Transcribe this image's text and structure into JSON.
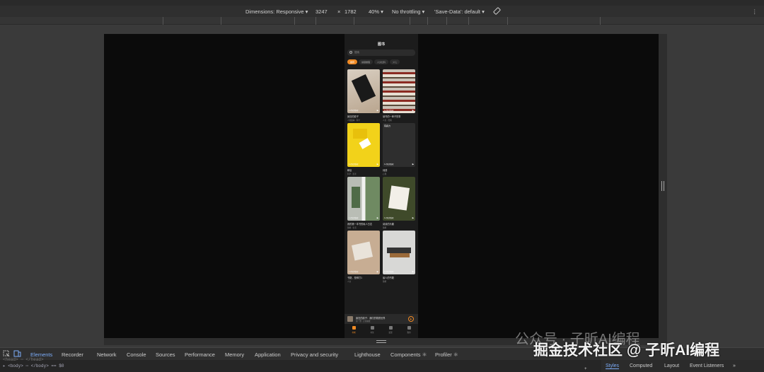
{
  "toolbar": {
    "dimensions_label": "Dimensions: Responsive ▾",
    "width": "3247",
    "times": "×",
    "height": "1782",
    "zoom": "40% ▾",
    "throttling": "No throttling ▾",
    "save_data": "'Save-Data': default ▾",
    "more": "⋮"
  },
  "phone": {
    "title": "图书",
    "search_placeholder": "搜索",
    "chips": [
      "推荐",
      "悬疑推理",
      "人文社科",
      "少儿"
    ],
    "cards": [
      {
        "title": "疯狂的原子",
        "subtitle": "人类故事 · 科学",
        "count": "1.2万次收听",
        "top_label": ""
      },
      {
        "title": "读书的一辈子的事",
        "subtitle": "人文 · 经典",
        "count": "1.2万次收听",
        "top_label": ""
      },
      {
        "title": "瞬息",
        "subtitle": "科学 · 思考",
        "count": "1.2万次收听",
        "top_label": ""
      },
      {
        "title": "钝感",
        "subtitle": "心理",
        "count": "1.2万次收听",
        "top_label": "钝感力"
      },
      {
        "title": "我的第一本书的私人日志",
        "subtitle": "随笔 · 生活",
        "count": "1.2万次收听",
        "top_label": ""
      },
      {
        "title": "阅读的乐趣",
        "subtitle": "随笔",
        "count": "1.2万次收听",
        "top_label": ""
      },
      {
        "title": "书籍，是种打1",
        "subtitle": "人文",
        "count": "1.2万次收听",
        "top_label": ""
      },
      {
        "title": "最人的书籍",
        "subtitle": "随笔",
        "count": "1.2万次收听",
        "top_label": ""
      }
    ],
    "miniplayer": {
      "title": "疯狂的原子：我们的物质世界",
      "subtitle": "第一章 · 正在播放",
      "play": "▶"
    },
    "tabs": [
      "书城",
      "书架",
      "发现",
      "我的"
    ]
  },
  "devtools": {
    "tabs": [
      "Elements",
      "Recorder",
      "Network",
      "Console",
      "Sources",
      "Performance",
      "Memory",
      "Application",
      "Privacy and security",
      "Lighthouse",
      "Components ⚛",
      "Profiler ⚛"
    ],
    "code_line1": "<head> ⋯ </head>",
    "code_line2": "▸ <body> ⋯ </body> == $0",
    "styles_tabs": [
      "Styles",
      "Computed",
      "Layout",
      "Event Listeners",
      "»"
    ]
  },
  "watermark": {
    "line1": "公众号 · 子昕AI编程",
    "line2": "掘金技术社区 @ 子昕AI编程"
  },
  "colors": {
    "accent": "#f08a24",
    "devtools_active": "#7cacf8"
  }
}
